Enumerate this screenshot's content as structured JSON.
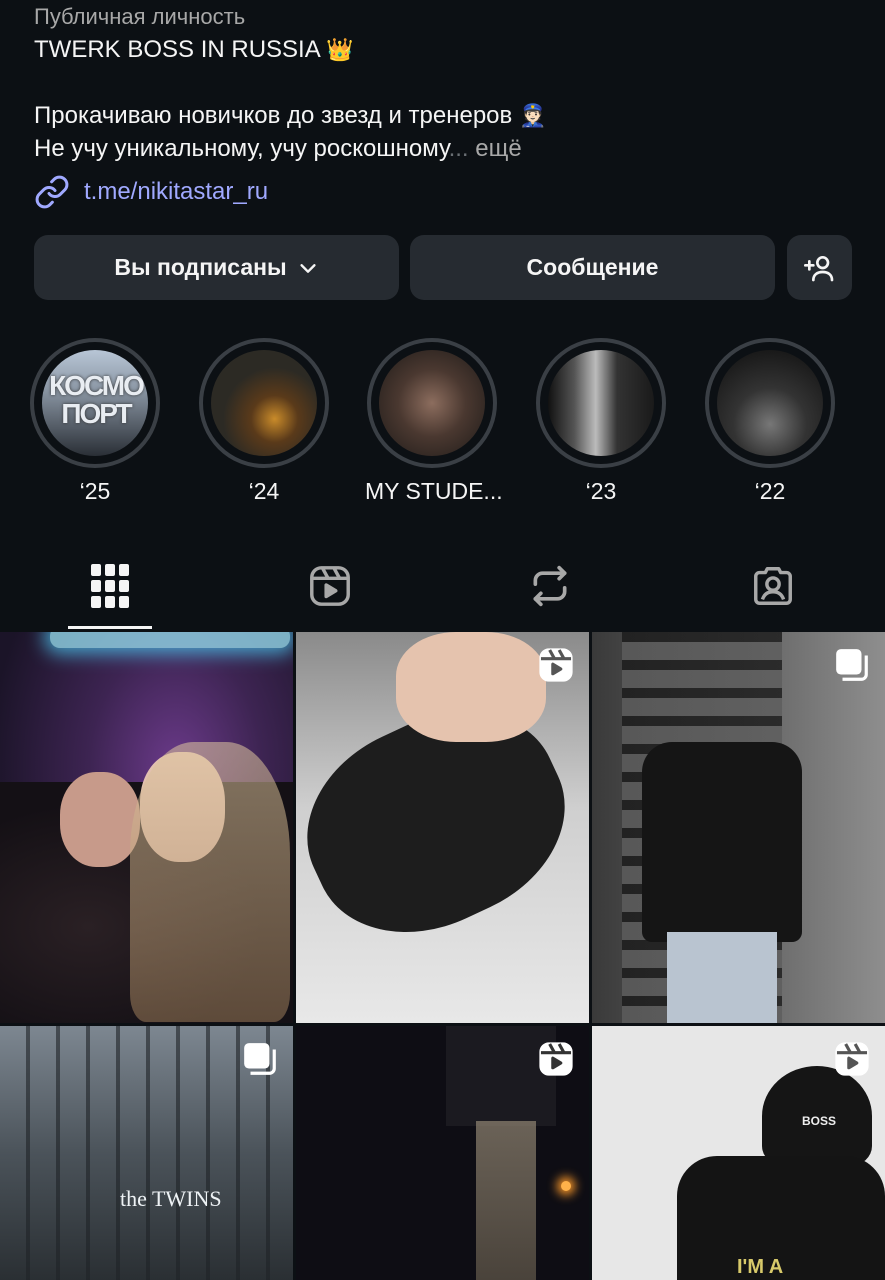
{
  "profile": {
    "category": "Публичная личность",
    "bio_line1": "TWERK BOSS IN RUSSIA",
    "bio_line1_emoji": "👑",
    "bio_line2": "Прокачиваю новичков до звезд и тренеров",
    "bio_line2_emoji": "👮🏻",
    "bio_line3": "Не учу уникальному, учу роскошному",
    "bio_ellipsis": "...",
    "bio_more": "ещё",
    "link": "t.me/nikitastar_ru"
  },
  "actions": {
    "following_label": "Вы подписаны",
    "message_label": "Сообщение"
  },
  "highlights": [
    {
      "label": "‘25",
      "cover_text": "КОСМО ПОРТ"
    },
    {
      "label": "‘24"
    },
    {
      "label": "MY STUDE..."
    },
    {
      "label": "‘23"
    },
    {
      "label": "‘22"
    }
  ],
  "tabs": [
    "posts-grid",
    "reels",
    "reposts",
    "tagged"
  ],
  "grid": [
    {
      "type": "photo"
    },
    {
      "type": "reel"
    },
    {
      "type": "carousel"
    },
    {
      "type": "carousel",
      "overlay_text": "the TWINS"
    },
    {
      "type": "reel"
    },
    {
      "type": "reel",
      "overlay_text": "BOSS",
      "overlay_text2": "I'M A"
    }
  ],
  "colors": {
    "background": "#0c1014",
    "button": "#262b31",
    "link": "#a0a9ff",
    "muted": "#a8a8a8"
  }
}
